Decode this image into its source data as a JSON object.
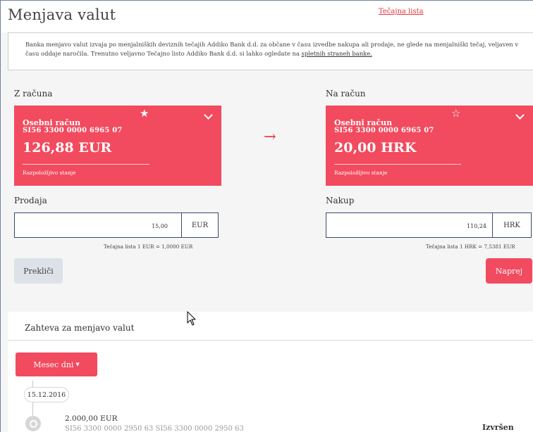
{
  "header": {
    "title": "Menjava valut",
    "rates_link": "Tečajna lista"
  },
  "notice": {
    "text": "Banka menjavo valut izvaja po menjalniških deviznih tečajih Addiko Bank d.d. za občane v času izvedbe nakupa ali prodaje, ne glede na menjalniški tečaj, veljaven v času oddaje naročila. Trenutno veljavno Tečajno listo Addiko Bank d.d. si lahko ogledate na ",
    "link": "spletnih straneh banke."
  },
  "from": {
    "label": "Z računa",
    "card": {
      "name": "Osebni račun",
      "iban": "SI56 3300 0000 6965 07",
      "amount": "126,88 EUR",
      "available_label": "Razpoložljivo stanje",
      "star": "★",
      "favorite": true
    },
    "side_label": "Prodaja",
    "value": "15,00",
    "currency": "EUR",
    "rate_note": "Tečajna lista 1 EUR = 1,0000  EUR"
  },
  "to": {
    "label": "Na račun",
    "card": {
      "name": "Osebni račun",
      "iban": "SI56 3300 0000 6965 07",
      "amount": "20,00 HRK",
      "available_label": "Razpoložljivo stanje",
      "star": "☆",
      "favorite": false
    },
    "side_label": "Nakup",
    "value": "110,24",
    "currency": "HRK",
    "rate_note": "Tečajna lista 1 HRK = 7,5381  EUR"
  },
  "arrow": "→",
  "buttons": {
    "cancel": "Prekliči",
    "next": "Naprej"
  },
  "history": {
    "title": "Zahteva za menjavo valut",
    "filter": "Mesec dni",
    "filter_caret": "▼",
    "date": "15.12.2016",
    "items": [
      {
        "amount": "2.000,00 EUR",
        "accounts": "SI56 3300 0000 2950 63      SI56 3300 0000 2950 63",
        "status": "Izvršen"
      }
    ]
  },
  "colors": {
    "accent": "#f24a5e",
    "link": "#e3353f",
    "panel": "#f5f5f5"
  }
}
